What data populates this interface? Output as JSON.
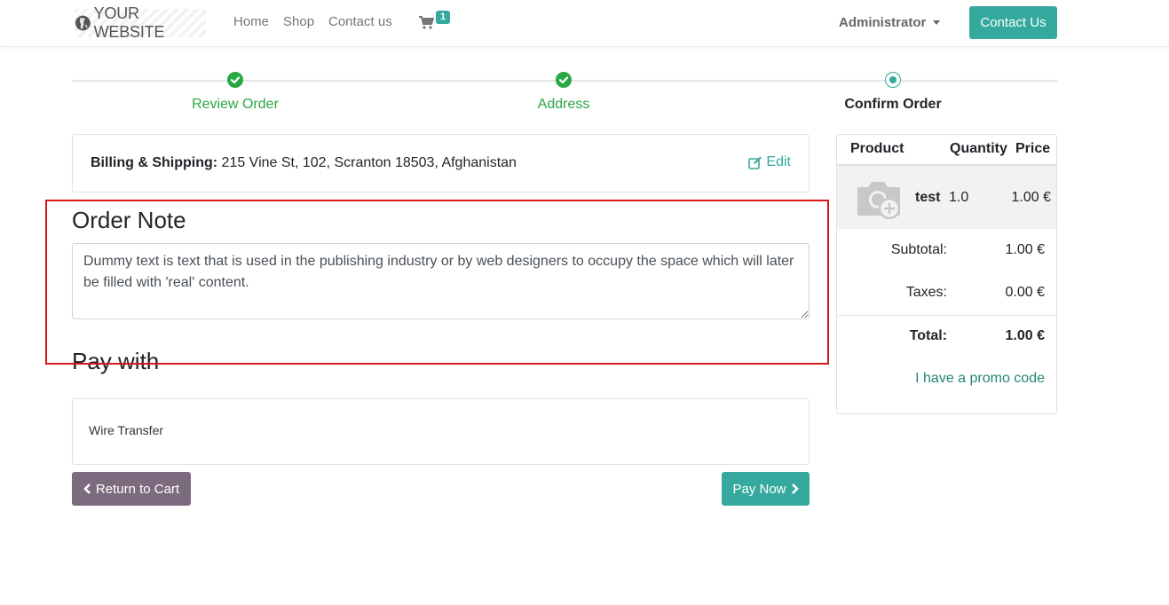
{
  "header": {
    "brand": "YOUR WEBSITE",
    "nav": [
      {
        "label": "Home"
      },
      {
        "label": "Shop"
      },
      {
        "label": "Contact us"
      }
    ],
    "cart_count": "1",
    "user": "Administrator",
    "contact_button": "Contact Us"
  },
  "steps": [
    {
      "label": "Review Order",
      "state": "done"
    },
    {
      "label": "Address",
      "state": "done"
    },
    {
      "label": "Confirm Order",
      "state": "current"
    }
  ],
  "billing": {
    "label": "Billing & Shipping:",
    "address": " 215 Vine St, 102, Scranton 18503, Afghanistan",
    "edit_label": "Edit"
  },
  "order_note": {
    "heading": "Order Note",
    "value": "Dummy text is text that is used in the publishing industry or by web designers to occupy the space which will later be filled with 'real' content."
  },
  "payment": {
    "heading": "Pay with",
    "option": "Wire Transfer"
  },
  "actions": {
    "return_label": "Return to Cart",
    "pay_label": "Pay Now"
  },
  "summary": {
    "columns": {
      "product": "Product",
      "quantity": "Quantity",
      "price": "Price"
    },
    "items": [
      {
        "name": "test",
        "quantity": "1.0",
        "price": "1.00 €"
      }
    ],
    "subtotal_label": "Subtotal:",
    "subtotal_value": "1.00 €",
    "taxes_label": "Taxes:",
    "taxes_value": "0.00 €",
    "total_label": "Total:",
    "total_value": "1.00 €",
    "promo_label": "I have a promo code"
  },
  "colors": {
    "accent": "#35a99e",
    "success": "#28a745",
    "secondary": "#7c6a7e",
    "highlight_border": "#d9171b"
  }
}
